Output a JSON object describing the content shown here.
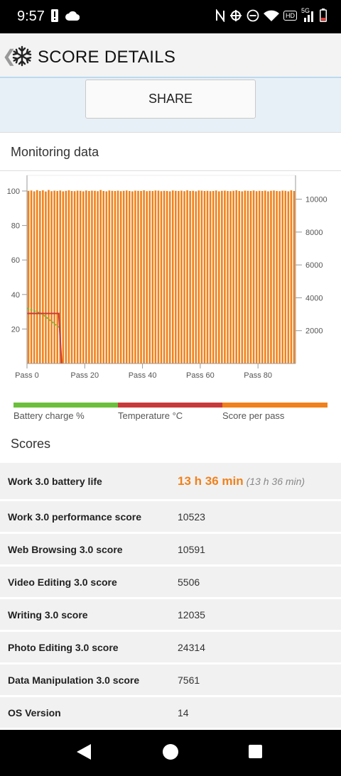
{
  "status_bar": {
    "time": "9:57",
    "left_icons": [
      "alert-icon",
      "cloud-icon"
    ],
    "right_icons": [
      "nfc-icon",
      "data-saver-icon",
      "dnd-icon",
      "wifi-icon",
      "hd-icon",
      "signal-icon",
      "battery-icon"
    ],
    "hd_label": "HD",
    "network_label": "5G"
  },
  "app_bar": {
    "title": "SCORE DETAILS",
    "back_glyph": "❮"
  },
  "share": {
    "label": "SHARE"
  },
  "monitoring": {
    "title": "Monitoring data",
    "legend": [
      {
        "label": "Battery charge %",
        "color": "#6cbf3a"
      },
      {
        "label": "Temperature °C",
        "color": "#c83a3a"
      },
      {
        "label": "Score per pass",
        "color": "#f0811b"
      }
    ]
  },
  "chart_data": {
    "type": "bar",
    "x_tick_labels": [
      "Pass 0",
      "Pass 20",
      "Pass 40",
      "Pass 60",
      "Pass 80"
    ],
    "x_tick_values": [
      0,
      20,
      40,
      60,
      80
    ],
    "xlim": [
      0,
      93
    ],
    "left_axis": {
      "ticks": [
        20,
        40,
        60,
        80,
        100
      ],
      "range": [
        0,
        100
      ]
    },
    "right_axis": {
      "ticks": [
        2000,
        4000,
        6000,
        8000,
        10000
      ],
      "range": [
        0,
        10500
      ]
    },
    "series": [
      {
        "name": "Score per pass",
        "axis": "right",
        "color": "#f0811b",
        "values": [
          10510,
          10530,
          10480,
          10550,
          10500,
          10540,
          10470,
          10560,
          10490,
          10520,
          10500,
          10530,
          10480,
          10510,
          10540,
          10500,
          10490,
          10520,
          10510,
          10480,
          10530,
          10500,
          10520,
          10510,
          10490,
          10560,
          10500,
          10480,
          10530,
          10510,
          10500,
          10520,
          10490,
          10510,
          10530,
          10500,
          10480,
          10520,
          10510,
          10500,
          10540,
          10490,
          10510,
          10500,
          10530,
          10520,
          10490,
          10510,
          10500,
          10480,
          10530,
          10510,
          10500,
          10520,
          10490,
          10540,
          10500,
          10510,
          10480,
          10530,
          10520,
          10500,
          10510,
          10490,
          10500,
          10530,
          10480,
          10510,
          10520,
          10500,
          10490,
          10510,
          10540,
          10500,
          10480,
          10520,
          10510,
          10500,
          10530,
          10490,
          10510,
          10500,
          10520,
          10480,
          10510,
          10530,
          10500,
          10490,
          10520,
          10510,
          10480,
          10540,
          10500
        ]
      },
      {
        "name": "Battery charge %",
        "axis": "left",
        "color": "#6cbf3a",
        "points": [
          [
            0,
            32
          ],
          [
            5,
            29
          ],
          [
            11,
            21
          ]
        ]
      },
      {
        "name": "Temperature °C",
        "axis": "left",
        "color": "#c83a3a",
        "points": [
          [
            0,
            29
          ],
          [
            11,
            29
          ],
          [
            12,
            0
          ]
        ]
      }
    ]
  },
  "scores": {
    "title": "Scores",
    "rows": [
      {
        "label": "Work 3.0 battery life",
        "value": "13 h 36 min",
        "sub": "(13 h 36 min)"
      },
      {
        "label": "Work 3.0 performance score",
        "value": "10523"
      },
      {
        "label": "Web Browsing 3.0 score",
        "value": "10591"
      },
      {
        "label": "Video Editing 3.0 score",
        "value": "5506"
      },
      {
        "label": "Writing 3.0 score",
        "value": "12035"
      },
      {
        "label": "Photo Editing 3.0 score",
        "value": "24314"
      },
      {
        "label": "Data Manipulation 3.0 score",
        "value": "7561"
      },
      {
        "label": "OS Version",
        "value": "14"
      }
    ]
  },
  "nav_bar": {
    "icons": [
      "back-triangle-icon",
      "home-circle-icon",
      "recents-square-icon"
    ]
  }
}
